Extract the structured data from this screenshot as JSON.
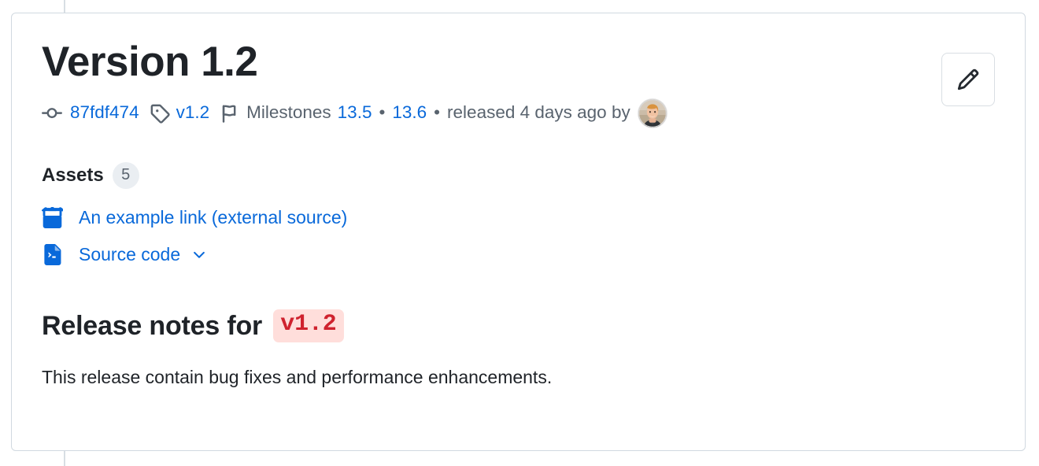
{
  "card": {
    "title": "Version 1.2",
    "edit_button_label": "Edit release",
    "edit_icon": "pencil-icon"
  },
  "meta": {
    "commit_icon": "git-commit-icon",
    "commit_sha": "87fdf474",
    "tag_icon": "tag-icon",
    "tag_name": "v1.2",
    "milestone_icon": "milestone-flag-icon",
    "milestones_label": "Milestones",
    "milestones": [
      "13.5",
      "13.6"
    ],
    "separator": "•",
    "released_text": "released 4 days ago by",
    "author_avatar": "author-avatar"
  },
  "assets": {
    "heading": "Assets",
    "count": "5",
    "items": [
      {
        "icon": "package-icon",
        "label": "An example link (external source)",
        "has_chevron": false
      },
      {
        "icon": "file-code-icon",
        "label": "Source code",
        "has_chevron": true,
        "chevron_icon": "chevron-down-icon"
      }
    ]
  },
  "notes": {
    "heading_prefix": "Release notes for ",
    "heading_code": "v1.2",
    "body": "This release contain bug fixes and performance enhancements."
  },
  "colors": {
    "link": "#0969da",
    "muted_text": "#59636e",
    "text": "#1f2328",
    "border": "#d1d9e0",
    "badge_bg": "#eaeef2",
    "code_text": "#cf222e",
    "code_bg": "#ffdedb",
    "rail": "#d8dee4"
  }
}
